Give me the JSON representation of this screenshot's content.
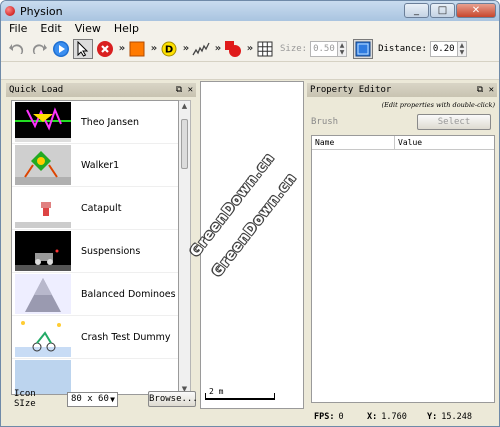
{
  "app": {
    "title": "Physion"
  },
  "window_buttons": {
    "minimize": "_",
    "maximize": "□",
    "close": "✕"
  },
  "menu": [
    "File",
    "Edit",
    "View",
    "Help"
  ],
  "toolbar": {
    "more": "»",
    "size_label": "Size:",
    "size_value": "0.50",
    "distance_label": "Distance:",
    "distance_value": "0.20",
    "icons": [
      "undo-icon",
      "redo-icon",
      "play-icon",
      "pointer-icon",
      "stop-icon",
      "box-icon",
      "d-tool-icon",
      "spring-icon",
      "brush-icon",
      "grid-icon",
      "snap-icon"
    ]
  },
  "quick_load": {
    "title": "Quick Load",
    "items": [
      {
        "label": "Theo Jansen"
      },
      {
        "label": "Walker1"
      },
      {
        "label": "Catapult"
      },
      {
        "label": "Suspensions"
      },
      {
        "label": "Balanced Dominoes"
      },
      {
        "label": "Crash Test Dummy"
      },
      {
        "label": ""
      }
    ],
    "icon_size_label": "Icon SIze",
    "icon_size_value": "80 x 60",
    "browse_label": "Browse..."
  },
  "canvas": {
    "scale_label": "2 m"
  },
  "property_editor": {
    "title": "Property Editor",
    "hint": "(Edit properties with double-click)",
    "brush_label": "Brush",
    "select_label": "Select",
    "columns": [
      "Name",
      "Value"
    ]
  },
  "status": {
    "fps_label": "FPS:",
    "fps_value": "0",
    "x_label": "X:",
    "x_value": "1.760",
    "y_label": "Y:",
    "y_value": "15.248"
  },
  "watermark": [
    "GreenDown.cn",
    "GreenDown.cn"
  ],
  "colors": {
    "accent": "#316ac5",
    "stop": "#d92020",
    "box": "#ff7a00"
  }
}
